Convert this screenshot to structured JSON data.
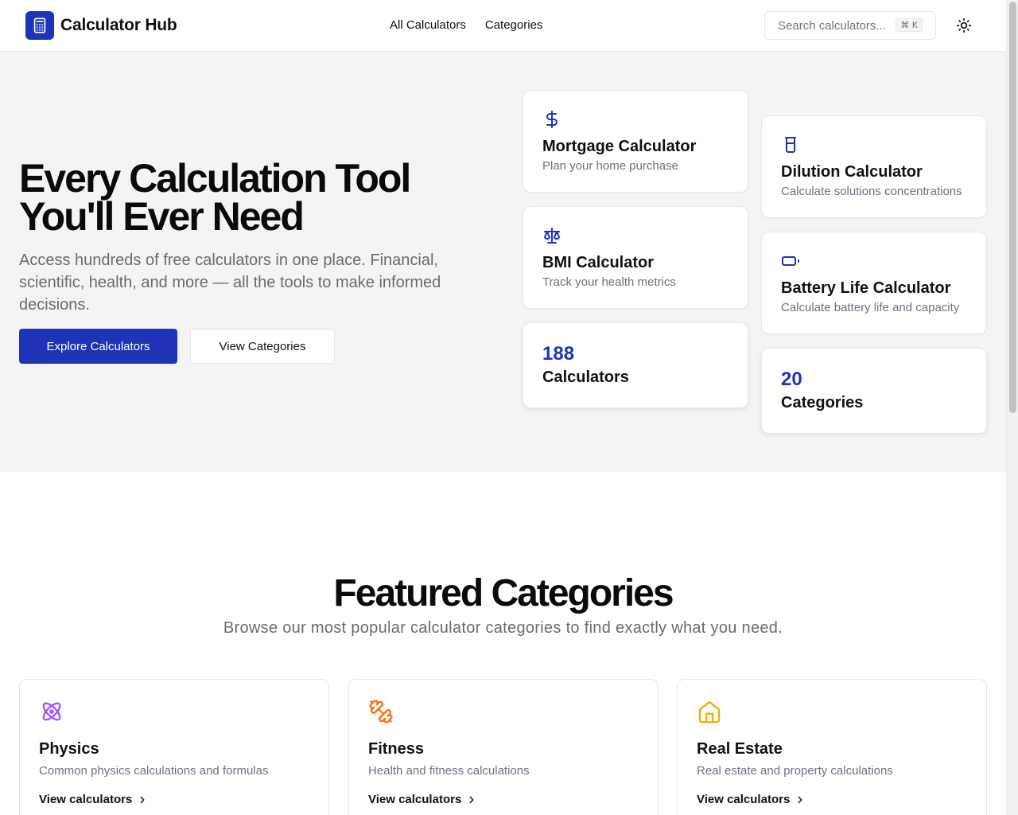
{
  "header": {
    "brand": "Calculator Hub",
    "nav": [
      "All Calculators",
      "Categories"
    ],
    "search_placeholder": "Search calculators...",
    "search_shortcut": "⌘ K"
  },
  "hero": {
    "title_line1": "Every Calculation Tool",
    "title_line2": "You'll Ever Need",
    "subtitle": "Access hundreds of free calculators in one place. Financial, scientific, health, and more — all the tools to make informed decisions.",
    "primary_button": "Explore Calculators",
    "secondary_button": "View Categories",
    "cards": [
      {
        "icon": "dollar-icon",
        "title": "Mortgage Calculator",
        "desc": "Plan your home purchase"
      },
      {
        "icon": "scale-icon",
        "title": "BMI Calculator",
        "desc": "Track your health metrics"
      },
      {
        "icon": "beaker-icon",
        "title": "Dilution Calculator",
        "desc": "Calculate solutions concentrations"
      },
      {
        "icon": "battery-icon",
        "title": "Battery Life Calculator",
        "desc": "Calculate battery life and capacity"
      }
    ],
    "stats": [
      {
        "value": "188",
        "label": "Calculators"
      },
      {
        "value": "20",
        "label": "Categories"
      }
    ]
  },
  "featured": {
    "title": "Featured Categories",
    "subtitle": "Browse our most popular calculator categories to find exactly what you need.",
    "categories": [
      {
        "icon": "atom-icon",
        "color": "#a855f7",
        "title": "Physics",
        "desc": "Common physics calculations and formulas",
        "link": "View calculators"
      },
      {
        "icon": "dumbbell-icon",
        "color": "#f97316",
        "title": "Fitness",
        "desc": "Health and fitness calculations",
        "link": "View calculators"
      },
      {
        "icon": "house-icon",
        "color": "#eab308",
        "title": "Real Estate",
        "desc": "Real estate and property calculations",
        "link": "View calculators"
      }
    ]
  },
  "colors": {
    "accent": "#1e33b8",
    "hero_bg": "#f4f4f4"
  }
}
